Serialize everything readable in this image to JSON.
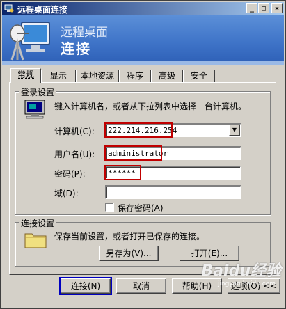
{
  "window": {
    "title": "远程桌面连接",
    "controls": {
      "minimize": "_",
      "maximize": "□",
      "close": "×"
    }
  },
  "banner": {
    "line1": "远程桌面",
    "line2": "连接"
  },
  "tabs": [
    {
      "label": "常规",
      "active": true
    },
    {
      "label": "显示"
    },
    {
      "label": "本地资源"
    },
    {
      "label": "程序"
    },
    {
      "label": "高级"
    },
    {
      "label": "安全"
    }
  ],
  "login": {
    "group_label": "登录设置",
    "hint": "键入计算机名，或者从下拉列表中选择一台计算机。",
    "computer": {
      "label": "计算机(C):",
      "value": "222.214.216.254"
    },
    "username": {
      "label": "用户名(U):",
      "value": "administrator"
    },
    "password": {
      "label": "密码(P):",
      "value": "******"
    },
    "domain": {
      "label": "域(D):",
      "value": ""
    },
    "save_password": {
      "label": "保存密码(A)",
      "checked": false
    }
  },
  "connection": {
    "group_label": "连接设置",
    "hint": "保存当前设置，或者打开已保存的连接。",
    "save_as": "另存为(V)...",
    "open": "打开(E)..."
  },
  "footer": {
    "connect": "连接(N)",
    "cancel": "取消",
    "help": "帮助(H)",
    "options": "选项(O) <<"
  },
  "watermark": {
    "main": "Baidu经验",
    "sub": "jingyan.baidu.com"
  },
  "colors": {
    "highlight": "#c00000",
    "connect_highlight": "#0000c0",
    "banner": "#3f74c8"
  }
}
